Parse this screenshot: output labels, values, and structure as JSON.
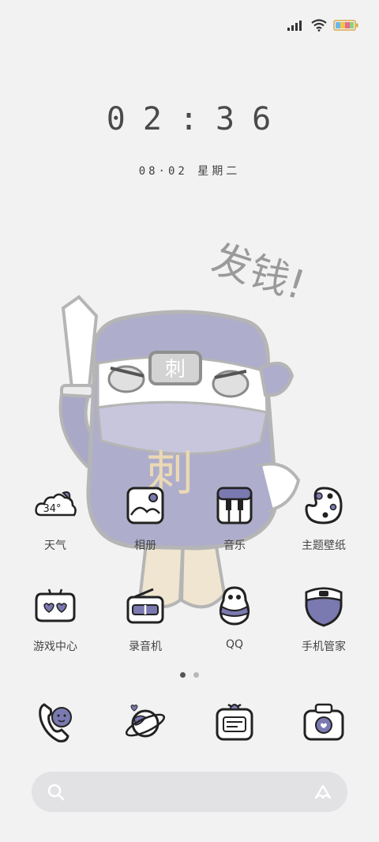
{
  "status_bar": {
    "signal_icon": "signal-bars-icon",
    "wifi_icon": "wifi-icon",
    "battery_icon": "battery-icon",
    "battery_level": 1.0,
    "battery_colors": [
      "#6bb7e8",
      "#f2c64b",
      "#e86b8a",
      "#8fd07a"
    ]
  },
  "lockscreen": {
    "time": "02:36",
    "date": "08·02 星期二"
  },
  "wallpaper": {
    "caption": "发钱!",
    "headband_text": "刺",
    "shirt_text": "刺"
  },
  "home": {
    "row1": [
      {
        "label": "天气",
        "icon": "weather-cloud-icon",
        "temp": "34°"
      },
      {
        "label": "相册",
        "icon": "photo-album-icon"
      },
      {
        "label": "音乐",
        "icon": "music-piano-icon"
      },
      {
        "label": "主题壁纸",
        "icon": "theme-palette-icon"
      }
    ],
    "row2": [
      {
        "label": "游戏中心",
        "icon": "game-controller-icon"
      },
      {
        "label": "录音机",
        "icon": "recorder-radio-icon"
      },
      {
        "label": "QQ",
        "icon": "qq-penguin-icon"
      },
      {
        "label": "手机管家",
        "icon": "security-shield-icon"
      }
    ],
    "page_count": 2,
    "current_page": 1
  },
  "dock": [
    {
      "icon": "phone-icon"
    },
    {
      "icon": "browser-planet-icon"
    },
    {
      "icon": "messages-icon"
    },
    {
      "icon": "camera-icon"
    }
  ],
  "search_bar": {
    "search_icon": "search-icon",
    "assistant_icon": "assistant-icon"
  },
  "colors": {
    "background": "#f3f2f3",
    "accent": "#7a79b0",
    "text": "#444444"
  }
}
